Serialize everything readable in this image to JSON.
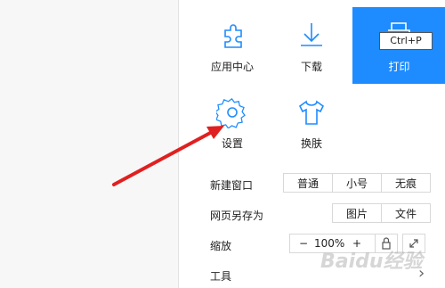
{
  "tiles": {
    "app_center": "应用中心",
    "download": "下载",
    "print": "打印",
    "settings": "设置",
    "skin": "换肤"
  },
  "tooltip": "Ctrl+P",
  "rows": {
    "new_window": {
      "label": "新建窗口",
      "options": [
        "普通",
        "小号",
        "无痕"
      ]
    },
    "save_as": {
      "label": "网页另存为",
      "options": [
        "图片",
        "文件"
      ]
    },
    "zoom": {
      "label": "缩放",
      "minus": "−",
      "value": "100%",
      "plus": "+"
    },
    "tools": {
      "label": "工具",
      "chevron": "›"
    }
  },
  "watermark": "Baidu经验",
  "colors": {
    "accent": "#1e8cff",
    "arrow": "#e02020"
  }
}
